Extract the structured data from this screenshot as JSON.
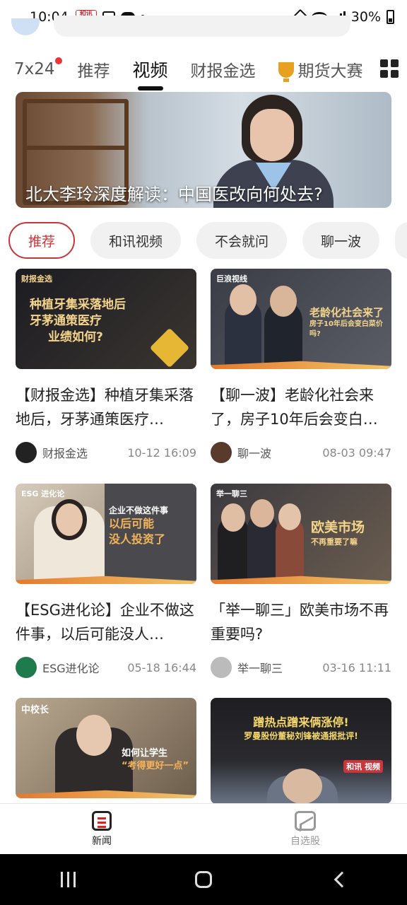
{
  "status_bar": {
    "time": "10:04",
    "battery": "30%"
  },
  "top_tabs": [
    {
      "label": "7x24",
      "badge": true
    },
    {
      "label": "推荐"
    },
    {
      "label": "视频",
      "active": true
    },
    {
      "label": "财报金选"
    },
    {
      "label": "期货大赛",
      "icon": "trophy-icon"
    }
  ],
  "banner": {
    "title": "北大李玲深度解读：中国医改向何处去?"
  },
  "chips": [
    "推荐",
    "和讯视频",
    "不会就问",
    "聊一波"
  ],
  "cards": [
    {
      "thumb_text": [
        "种植牙集采落地后",
        "牙茅通策医疗",
        "业绩如何?"
      ],
      "thumb_tag": "财报金选",
      "title": "【财报金选】种植牙集采落地后，牙茅通策医疗…",
      "source": "财报金选",
      "time": "10-12 16:09"
    },
    {
      "thumb_text": [
        "老龄化社会来了",
        "房子10年后会变白菜价吗?"
      ],
      "thumb_tag": "巨浪视线",
      "title": "【聊一波】老龄化社会来了，房子10年后会变白…",
      "source": "聊一波",
      "time": "08-03 09:47"
    },
    {
      "thumb_text": [
        "企业不做这件事",
        "以后可能",
        "没人投资了"
      ],
      "thumb_tag": "ESG 进化论",
      "title": "【ESG进化论】企业不做这件事，以后可能没人…",
      "source": "ESG进化论",
      "time": "05-18 16:44"
    },
    {
      "thumb_text": [
        "欧美市场",
        "不再重要了嘛"
      ],
      "thumb_tag": "举一聊三",
      "title": "「举一聊三」欧美市场不再重要吗?",
      "source": "举一聊三",
      "time": "03-16 11:11"
    },
    {
      "thumb_text": [
        "如何让学生",
        "“考得更好一点”"
      ],
      "thumb_tag": "中校长"
    },
    {
      "thumb_text": [
        "蹭热点蹭来俩涨停!",
        "罗曼股份董秘刘锋被通报批评!"
      ],
      "thumb_tag": "和讯 视频"
    }
  ],
  "bottom_nav": [
    {
      "label": "新闻",
      "active": true
    },
    {
      "label": "自选股"
    }
  ],
  "colors": {
    "accent": "#c8353a",
    "text": "#222222"
  }
}
